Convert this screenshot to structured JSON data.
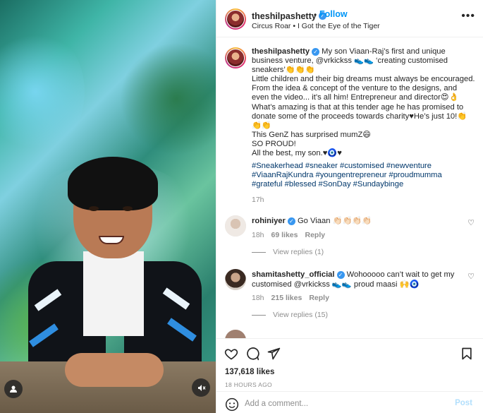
{
  "post": {
    "username": "theshilpashetty",
    "follow_label": "Follow",
    "dot": "•",
    "audio": "Circus Roar • I Got the Eye of the Tiger",
    "caption": {
      "username": "theshilpashetty",
      "text": "My son Viaan-Raj’s first and unique business venture, @vrkickss 👟👟 ‘creating customised sneakers’👏👏👏\nLittle children and their big dreams must always be encouraged. From the idea & concept of the venture to the designs, and even the video... it’s all him! Entrepreneur and director😍👌\nWhat’s amazing is that at this tender age he has promised to donate some of the proceeds towards charity♥He’s just 10!👏👏👏\nThis GenZ has surprised mumZ😄\nSO PROUD!\nAll the best, my son.♥🧿♥",
      "hashtags": "#Sneakerhead #sneaker #customised #newventure #ViaanRajKundra #youngentrepreneur #proudmumma #grateful #blessed #SonDay #Sundaybinge",
      "time": "17h"
    },
    "comments": [
      {
        "username": "rohiniyer",
        "text": "Go Viaan 👏🏻👏🏻👏🏻👏🏻",
        "time": "18h",
        "likes": "69 likes",
        "reply": "Reply",
        "view_replies": "View replies (1)"
      },
      {
        "username": "shamitashetty_official",
        "text": "Wohooooo can’t wait to get my customised @vrkickss 👟👟 proud maasi 🙌🧿",
        "time": "18h",
        "likes": "215 likes",
        "reply": "Reply",
        "view_replies": "View replies (15)"
      }
    ],
    "likes_count": "137,618 likes",
    "time_ago": "18 HOURS AGO",
    "comment_placeholder": "Add a comment...",
    "post_label": "Post"
  },
  "icons": {
    "more": "•••",
    "verified": "✓",
    "heart_small": "♡"
  },
  "colors": {
    "accent": "#0095f6",
    "hashtag": "#00376b",
    "muted": "#8e8e8e"
  }
}
